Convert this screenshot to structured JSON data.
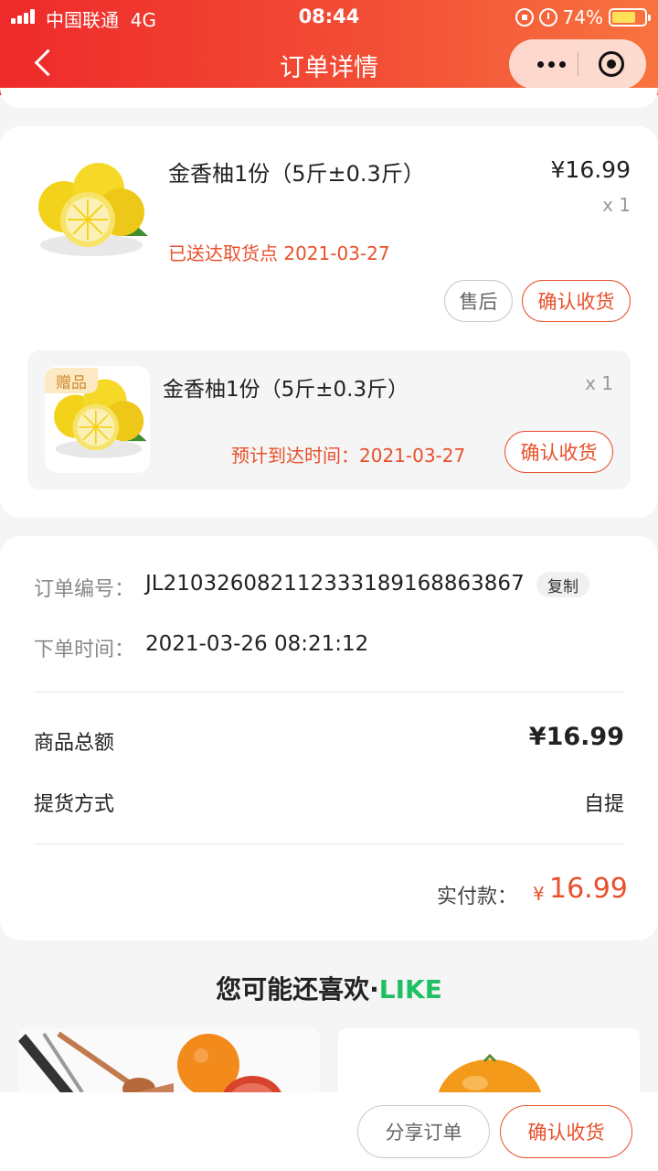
{
  "status_bar": {
    "carrier": "中国联通",
    "network": "4G",
    "time": "08:44",
    "battery_text": "74%",
    "battery_level": 0.74
  },
  "header": {
    "title": "订单详情"
  },
  "product": {
    "name": "金香柚1份（5斤±0.3斤）",
    "price": "¥16.99",
    "qty": "x 1",
    "status": "已送达取货点 2021-03-27",
    "after_sale_label": "售后",
    "confirm_label": "确认收货"
  },
  "gift": {
    "tag": "赠品",
    "name": "金香柚1份（5斤±0.3斤）",
    "qty": "x 1",
    "eta": "预计到达时间：2021-03-27",
    "confirm_label": "确认收货"
  },
  "order_info": {
    "number_label": "订单编号：",
    "number_value": "JL210326082112333189168863867",
    "copy_label": "复制",
    "time_label": "下单时间：",
    "time_value": "2021-03-26 08:21:12",
    "total_label": "商品总额",
    "total_value": "¥16.99",
    "pickup_label": "提货方式",
    "pickup_value": "自提",
    "paid_label": "实付款：",
    "paid_currency": "¥",
    "paid_value": "16.99"
  },
  "recommend": {
    "title": "您可能还喜欢·",
    "title_accent": "LIKE"
  },
  "bottom": {
    "share_label": "分享订单",
    "confirm_label": "确认收货"
  },
  "colors": {
    "accent": "#e8502c",
    "header_start": "#ee2a2a",
    "header_end": "#f8733f",
    "like_green": "#1fbf63",
    "gift_tag_bg": "#fde9c4"
  }
}
